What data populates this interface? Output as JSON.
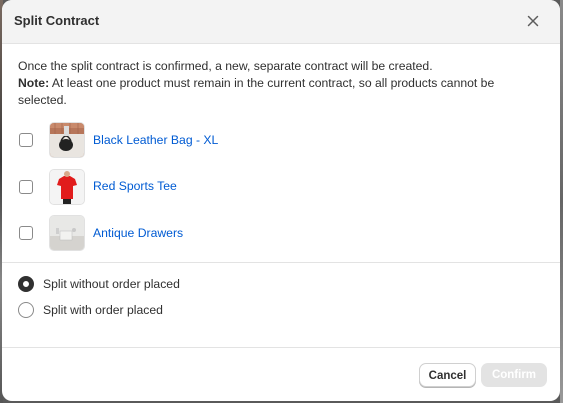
{
  "dialog": {
    "title": "Split Contract",
    "close_icon": "close-icon"
  },
  "message": {
    "line1": "Once the split contract is confirmed, a new, separate contract will be created.",
    "note_label": "Note:",
    "note_text": " At least one product must remain in the current contract, so all products cannot be selected."
  },
  "products": [
    {
      "name": "Black Leather Bag - XL",
      "checked": false,
      "thumb_icon": "black-bag-thumbnail"
    },
    {
      "name": "Red Sports Tee",
      "checked": false,
      "thumb_icon": "red-tee-thumbnail"
    },
    {
      "name": "Antique Drawers",
      "checked": false,
      "thumb_icon": "antique-drawers-thumbnail"
    }
  ],
  "options": [
    {
      "label": "Split without order placed",
      "selected": true
    },
    {
      "label": "Split with order placed",
      "selected": false
    }
  ],
  "footer": {
    "cancel_label": "Cancel",
    "confirm_label": "Confirm",
    "confirm_disabled": true
  }
}
